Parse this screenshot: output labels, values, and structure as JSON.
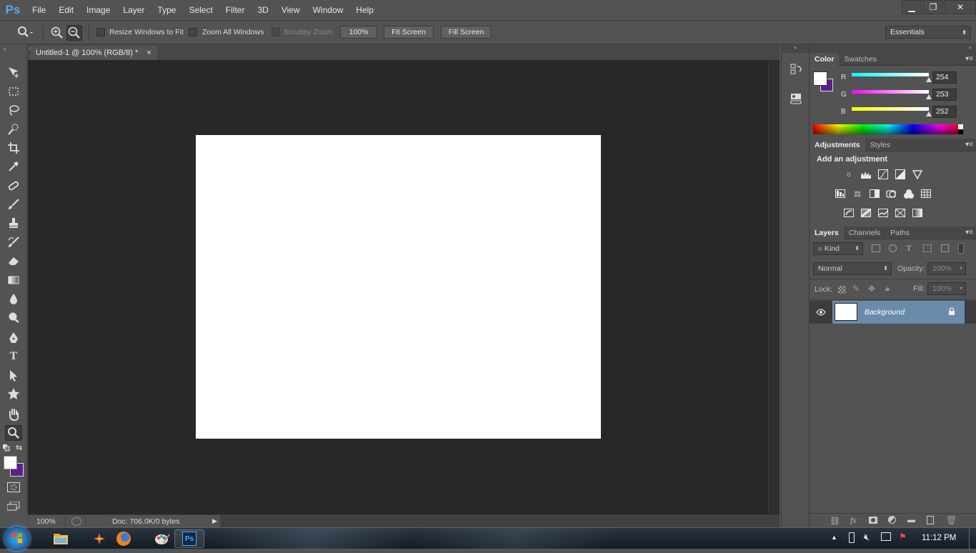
{
  "app": {
    "logo": "Ps",
    "colors": {
      "ui": "#535353",
      "canvas_bg": "#282828",
      "accent": "#5fa8e8",
      "fg_swatch": "#ffffff",
      "bg_swatch": "#5a1f8c"
    }
  },
  "menu": [
    "File",
    "Edit",
    "Image",
    "Layer",
    "Type",
    "Select",
    "Filter",
    "3D",
    "View",
    "Window",
    "Help"
  ],
  "window_controls": {
    "minimize": "▁",
    "restore": "❐",
    "close": "✕"
  },
  "options": {
    "resize_windows": "Resize Windows to Fit",
    "zoom_all": "Zoom All Windows",
    "scrubby": "Scrubby Zoom",
    "zoom_value": "100%",
    "fit_screen": "Fit Screen",
    "fill_screen": "Fill Screen",
    "workspace": "Essentials"
  },
  "document": {
    "tab_title": "Untitled-1 @ 100% (RGB/8) *",
    "close": "×"
  },
  "status": {
    "zoom": "100%",
    "doc": "Doc: 706.0K/0 bytes"
  },
  "color_panel": {
    "tabs": [
      "Color",
      "Swatches"
    ],
    "channels": [
      {
        "label": "R",
        "value": "254"
      },
      {
        "label": "G",
        "value": "253"
      },
      {
        "label": "B",
        "value": "252"
      }
    ]
  },
  "adjustments_panel": {
    "tabs": [
      "Adjustments",
      "Styles"
    ],
    "title": "Add an adjustment"
  },
  "layers_panel": {
    "tabs": [
      "Layers",
      "Channels",
      "Paths"
    ],
    "kind": "Kind",
    "blend": "Normal",
    "opacity_label": "Opacity:",
    "opacity": "100%",
    "lock_label": "Lock:",
    "fill_label": "Fill:",
    "fill": "100%",
    "layer_name": "Background"
  },
  "taskbar": {
    "clock": "11:12 PM"
  }
}
